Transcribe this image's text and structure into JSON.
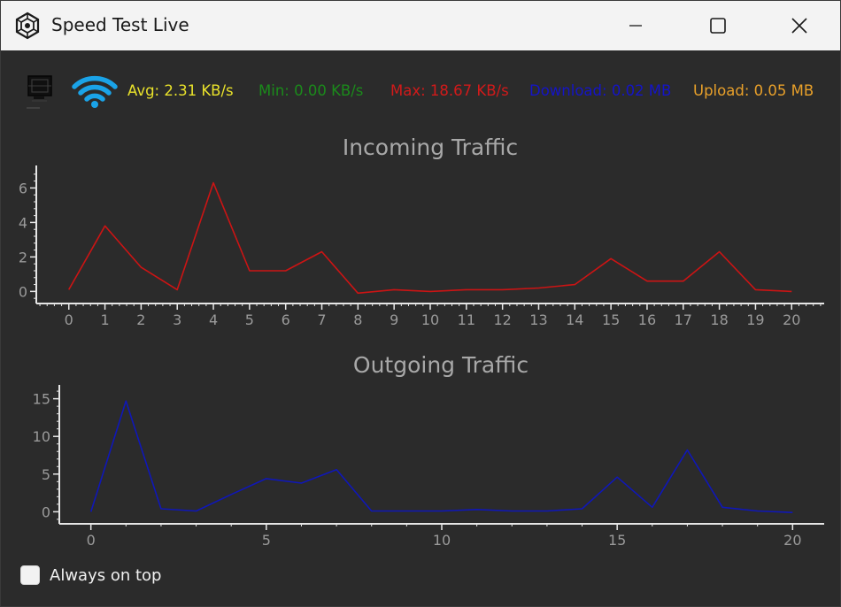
{
  "window": {
    "title": "Speed Test Live"
  },
  "colors": {
    "background": "#2b2b2b",
    "titlebar": "#f3f3f3",
    "axis": "#e6e6e6",
    "tick_label": "#9a9a9a",
    "chart_title": "#a8a8a8",
    "incoming_line": "#cc1414",
    "outgoing_line": "#0f17b8",
    "wifi": "#1aa3e8"
  },
  "toolbar": {
    "stats": {
      "avg": "Avg: 2.31 KB/s",
      "min": "Min: 0.00 KB/s",
      "max": "Max: 18.67 KB/s",
      "download": "Download: 0.02 MB",
      "upload": "Upload: 0.05 MB"
    },
    "stat_colors": {
      "avg": "#e9e22b",
      "min": "#1b8a1b",
      "max": "#d21a1a",
      "download": "#1414c8",
      "upload": "#e8a02a"
    },
    "icons": [
      "monitor-icon",
      "wifi-icon"
    ]
  },
  "options": {
    "always_on_top_label": "Always on top",
    "always_on_top_checked": false
  },
  "chart_data": [
    {
      "type": "line",
      "title": "Incoming Traffic",
      "x": [
        0,
        1,
        2,
        3,
        4,
        5,
        6,
        7,
        8,
        9,
        10,
        11,
        12,
        13,
        14,
        15,
        16,
        17,
        18,
        19,
        20
      ],
      "series": [
        {
          "values": [
            0.1,
            3.8,
            1.4,
            0.1,
            6.3,
            1.2,
            1.2,
            2.3,
            -0.1,
            0.1,
            0.0,
            0.1,
            0.1,
            0.2,
            0.4,
            1.9,
            0.6,
            0.6,
            2.3,
            0.1,
            0.0
          ]
        }
      ],
      "xticks": [
        0,
        1,
        2,
        3,
        4,
        5,
        6,
        7,
        8,
        9,
        10,
        11,
        12,
        13,
        14,
        15,
        16,
        17,
        18,
        19,
        20
      ],
      "yticks": [
        0,
        2,
        4,
        6
      ],
      "xlim": [
        -0.9,
        20.9
      ],
      "ylim": [
        -0.7,
        7.1
      ],
      "grid": false
    },
    {
      "type": "line",
      "title": "Outgoing Traffic",
      "x": [
        0,
        1,
        2,
        3,
        4,
        5,
        6,
        7,
        8,
        9,
        10,
        11,
        12,
        13,
        14,
        15,
        16,
        17,
        18,
        19,
        20
      ],
      "series": [
        {
          "values": [
            0.0,
            14.7,
            0.4,
            0.1,
            2.3,
            4.4,
            3.8,
            5.6,
            0.1,
            0.1,
            0.1,
            0.3,
            0.1,
            0.1,
            0.4,
            4.6,
            0.6,
            8.2,
            0.6,
            0.1,
            -0.1
          ]
        }
      ],
      "xticks": [
        0,
        5,
        10,
        15,
        20
      ],
      "yticks": [
        0,
        5,
        10,
        15
      ],
      "xlim": [
        -0.9,
        20.9
      ],
      "ylim": [
        -1.6,
        16.6
      ],
      "grid": false
    }
  ]
}
